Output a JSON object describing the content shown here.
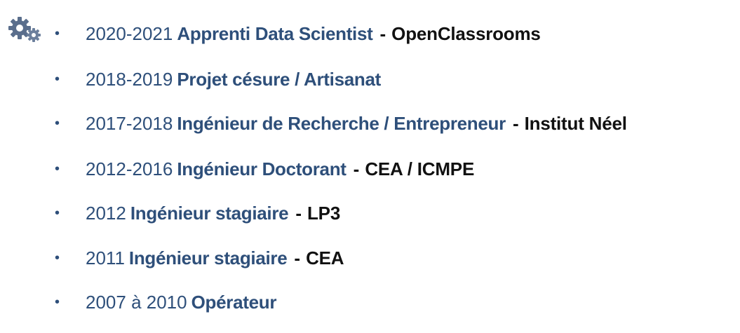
{
  "timeline": {
    "items": [
      {
        "bullet": "•",
        "date": "2020-2021",
        "role": "Apprenti Data Scientist",
        "sep": "-",
        "org": "OpenClassrooms"
      },
      {
        "bullet": "•",
        "date": "2018-2019",
        "role": "Projet césure / Artisanat",
        "sep": "",
        "org": ""
      },
      {
        "bullet": "•",
        "date": "2017-2018",
        "role": "Ingénieur de Recherche / Entrepreneur",
        "sep": "-",
        "org": "Institut Néel"
      },
      {
        "bullet": "•",
        "date": "2012-2016",
        "role": "Ingénieur Doctorant",
        "sep": "-",
        "org": "CEA / ICMPE"
      },
      {
        "bullet": "•",
        "date": "2012",
        "role": "Ingénieur stagiaire",
        "sep": "-",
        "org": "LP3"
      },
      {
        "bullet": "•",
        "date": "2011",
        "role": "Ingénieur stagiaire",
        "sep": "-",
        "org": "CEA"
      },
      {
        "bullet": "•",
        "date": "2007 à 2010",
        "role": "Opérateur",
        "sep": "",
        "org": ""
      }
    ]
  },
  "icons": {
    "header": "gears-icon"
  },
  "colors": {
    "accent": "#2e4f7a",
    "text": "#111111",
    "icon": "#5a6e8c"
  }
}
